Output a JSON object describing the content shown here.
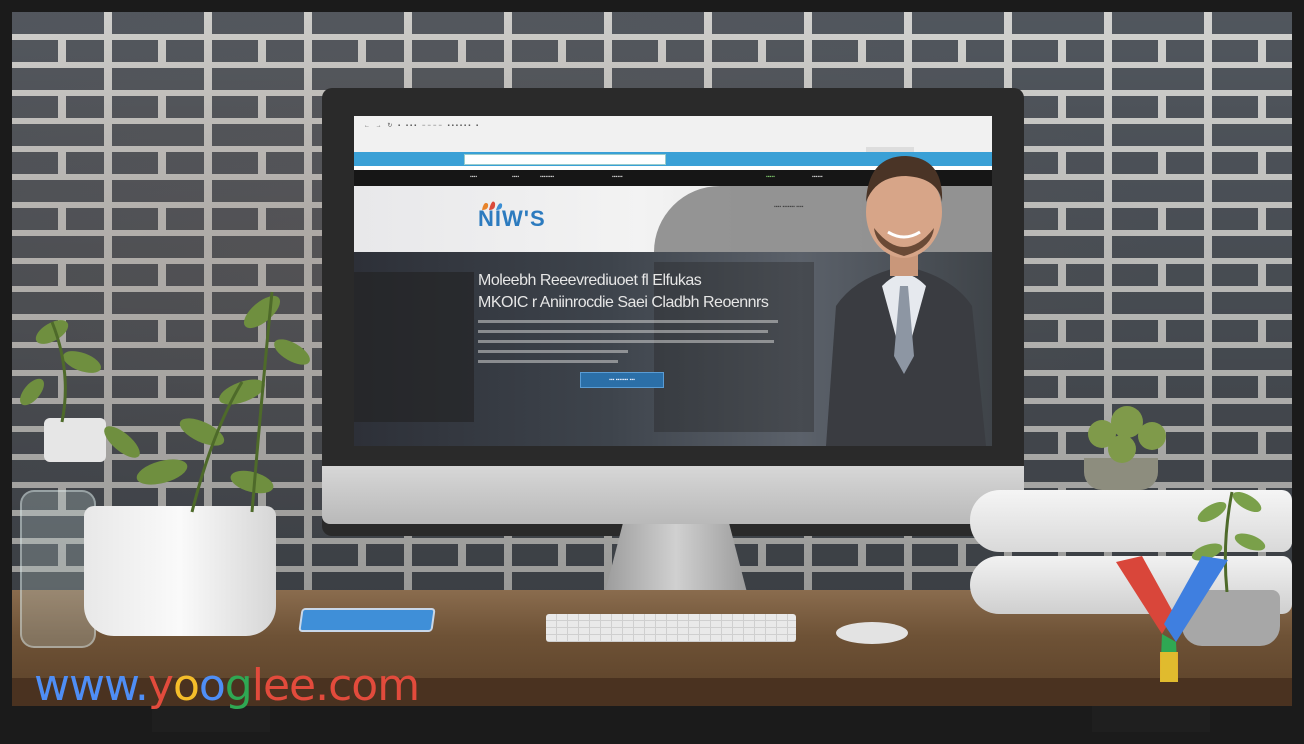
{
  "browser": {
    "tabs_text": "← → ↻  ▪ ▪▪▪ −−−−  ▪▪▪▪▪▪  ▪",
    "address_text": ""
  },
  "site": {
    "logo": "NIW'S",
    "header_link": "▪▪▪▪ ▪▪▪▪▪▪▪ ▪▪▪▪",
    "nav": [
      "▪▪▪▪",
      "▪▪▪▪",
      "▪▪▪▪▪▪▪▪",
      "▪▪▪▪▪▪",
      "▪▪▪▪▪",
      "▪▪▪▪▪▪"
    ],
    "hero": {
      "title_line1": "Moleebh Reeevrediuoet fl Elfukas",
      "title_line2": "MKOIC r Aniinrocdie Saei Cladbh Reoennrs",
      "cta_label": "▪▪▪ ▪▪▪▪▪▪▪ ▪▪▪"
    }
  },
  "watermark": {
    "parts": [
      "www.",
      "y",
      "o",
      "o",
      "g",
      "lee.com"
    ]
  },
  "colors": {
    "accent_blue": "#3aa0d6",
    "nav_black": "#161616",
    "cta_blue": "#2b6fa8",
    "logo_blue": "#2c7bbf"
  }
}
